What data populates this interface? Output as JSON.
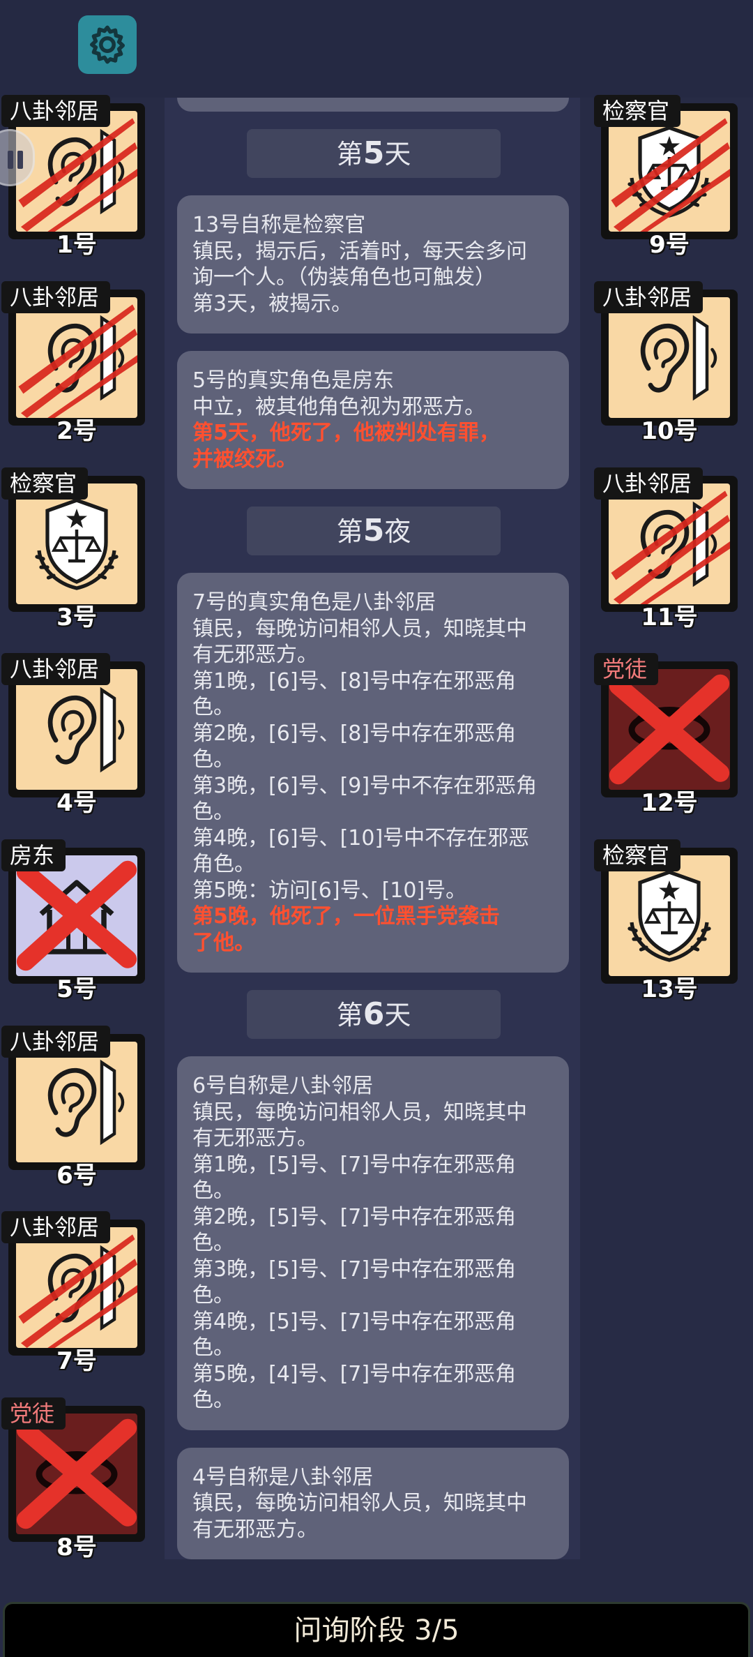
{
  "phase": "问询阶段 3/5",
  "players_left": [
    {
      "role": "八卦邻居",
      "num": "1号",
      "icon": "ear",
      "state": "clawed",
      "tag": "white"
    },
    {
      "role": "八卦邻居",
      "num": "2号",
      "icon": "ear",
      "state": "clawed",
      "tag": "white"
    },
    {
      "role": "检察官",
      "num": "3号",
      "icon": "prosecutor",
      "state": "normal",
      "tag": "white"
    },
    {
      "role": "八卦邻居",
      "num": "4号",
      "icon": "ear",
      "state": "normal",
      "tag": "white"
    },
    {
      "role": "房东",
      "num": "5号",
      "icon": "house",
      "state": "crossed",
      "tag": "white"
    },
    {
      "role": "八卦邻居",
      "num": "6号",
      "icon": "ear",
      "state": "normal",
      "tag": "white"
    },
    {
      "role": "八卦邻居",
      "num": "7号",
      "icon": "ear",
      "state": "clawed",
      "tag": "white"
    },
    {
      "role": "党徒",
      "num": "8号",
      "icon": "eye",
      "state": "crossed",
      "tag": "red"
    }
  ],
  "players_right": [
    {
      "role": "检察官",
      "num": "9号",
      "icon": "prosecutor",
      "state": "clawed",
      "tag": "white"
    },
    {
      "role": "八卦邻居",
      "num": "10号",
      "icon": "ear",
      "state": "normal",
      "tag": "white"
    },
    {
      "role": "八卦邻居",
      "num": "11号",
      "icon": "ear",
      "state": "clawed",
      "tag": "white"
    },
    {
      "role": "党徒",
      "num": "12号",
      "icon": "eye",
      "state": "crossed",
      "tag": "red"
    },
    {
      "role": "检察官",
      "num": "13号",
      "icon": "prosecutor",
      "state": "normal",
      "tag": "white"
    }
  ],
  "log": [
    {
      "kind": "header",
      "pre": "第",
      "num": "5",
      "post": "天"
    },
    {
      "kind": "msg",
      "lines": [
        {
          "t": "13号自称是检察官"
        },
        {
          "t": "镇民，揭示后，活着时，每天会多问"
        },
        {
          "t": "询一个人。（伪装角色也可触发）"
        },
        {
          "t": "第3天，被揭示。"
        }
      ]
    },
    {
      "kind": "msg",
      "lines": [
        {
          "t": "5号的真实角色是房东"
        },
        {
          "t": "中立，被其他角色视为邪恶方。"
        },
        {
          "t": "第5天，他死了，他被判处有罪，",
          "red": true
        },
        {
          "t": "并被绞死。",
          "red": true
        }
      ]
    },
    {
      "kind": "header",
      "pre": "第",
      "num": "5",
      "post": "夜"
    },
    {
      "kind": "msg",
      "lines": [
        {
          "t": "7号的真实角色是八卦邻居"
        },
        {
          "t": "镇民，每晚访问相邻人员，知晓其中"
        },
        {
          "t": "有无邪恶方。"
        },
        {
          "t": "第1晚，[6]号、[8]号中存在邪恶角"
        },
        {
          "t": "色。"
        },
        {
          "t": "第2晚，[6]号、[8]号中存在邪恶角"
        },
        {
          "t": "色。"
        },
        {
          "t": "第3晚，[6]号、[9]号中不存在邪恶角"
        },
        {
          "t": "色。"
        },
        {
          "t": "第4晚，[6]号、[10]号中不存在邪恶"
        },
        {
          "t": "角色。"
        },
        {
          "t": "第5晚：访问[6]号、[10]号。"
        },
        {
          "t": "第5晚，他死了，一位黑手党袭击",
          "red": true
        },
        {
          "t": "了他。",
          "red": true
        }
      ]
    },
    {
      "kind": "header",
      "pre": "第",
      "num": "6",
      "post": "天"
    },
    {
      "kind": "msg",
      "lines": [
        {
          "t": "6号自称是八卦邻居"
        },
        {
          "t": "镇民，每晚访问相邻人员，知晓其中"
        },
        {
          "t": "有无邪恶方。"
        },
        {
          "t": "第1晚，[5]号、[7]号中存在邪恶角"
        },
        {
          "t": "色。"
        },
        {
          "t": "第2晚，[5]号、[7]号中存在邪恶角"
        },
        {
          "t": "色。"
        },
        {
          "t": "第3晚，[5]号、[7]号中存在邪恶角"
        },
        {
          "t": "色。"
        },
        {
          "t": "第4晚，[5]号、[7]号中存在邪恶角"
        },
        {
          "t": "色。"
        },
        {
          "t": "第5晚，[4]号、[7]号中存在邪恶角"
        },
        {
          "t": "色。"
        }
      ]
    },
    {
      "kind": "msg",
      "lines": [
        {
          "t": "4号自称是八卦邻居"
        },
        {
          "t": "镇民，每晚访问相邻人员，知晓其中"
        },
        {
          "t": "有无邪恶方。"
        }
      ]
    }
  ]
}
